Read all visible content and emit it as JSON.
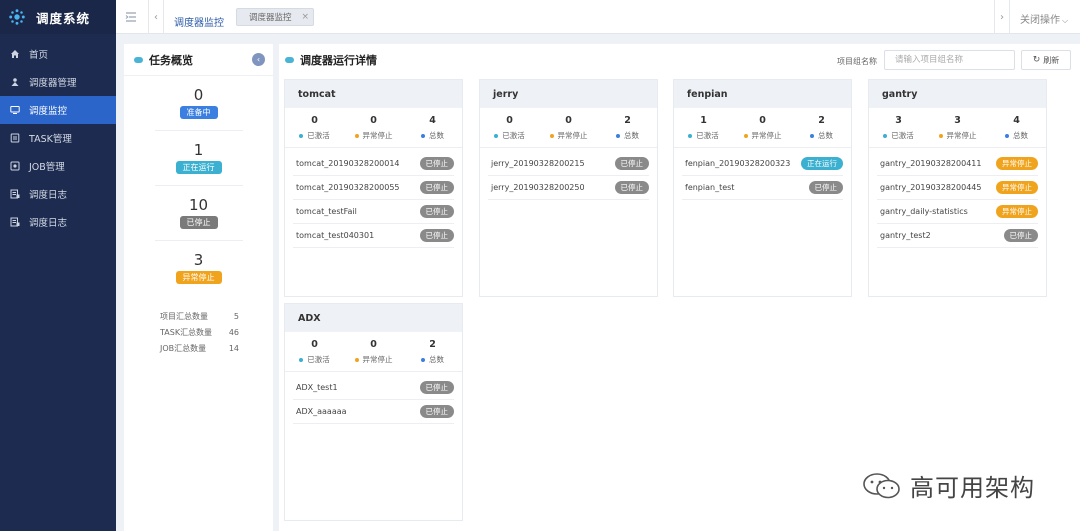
{
  "app": {
    "title": "调度系统"
  },
  "sidebar": {
    "items": [
      {
        "label": "首页",
        "icon": "home-icon"
      },
      {
        "label": "调度器管理",
        "icon": "scheduler-icon"
      },
      {
        "label": "调度监控",
        "icon": "monitor-icon",
        "active": true
      },
      {
        "label": "TASK管理",
        "icon": "task-icon"
      },
      {
        "label": "JOB管理",
        "icon": "job-icon"
      },
      {
        "label": "调度日志",
        "icon": "log-icon"
      },
      {
        "label": "调度日志",
        "icon": "log-icon"
      }
    ]
  },
  "topbar": {
    "page_title": "调度器监控",
    "tab_label": "调度器监控",
    "tab_close": "×",
    "close_ops": "关闭操作"
  },
  "overview": {
    "title": "任务概览",
    "stats": [
      {
        "value": "0",
        "label": "准备中",
        "color": "#3b7fe0"
      },
      {
        "value": "1",
        "label": "正在运行",
        "color": "#3bb0d0"
      },
      {
        "value": "10",
        "label": "已停止",
        "color": "#7a7a7a"
      },
      {
        "value": "3",
        "label": "异常停止",
        "color": "#f0a41e"
      }
    ],
    "summary": [
      {
        "label": "项目汇总数量",
        "value": "5"
      },
      {
        "label": "TASK汇总数量",
        "value": "46"
      },
      {
        "label": "JOB汇总数量",
        "value": "14"
      }
    ]
  },
  "main": {
    "title": "调度器运行详情",
    "search_label": "项目组名称",
    "search_placeholder": "请输入项目组名称",
    "refresh_label": "刷新",
    "stat_labels": [
      "已激活",
      "异常停止",
      "总数"
    ],
    "stat_colors": [
      "#3bb0d0",
      "#f0a41e",
      "#3b7fe0"
    ],
    "cards": [
      {
        "name": "tomcat",
        "stats": [
          "0",
          "0",
          "4"
        ],
        "tasks": [
          {
            "name": "tomcat_20190328200014",
            "status": "已停止",
            "color": "#8a8a8a"
          },
          {
            "name": "tomcat_20190328200055",
            "status": "已停止",
            "color": "#8a8a8a"
          },
          {
            "name": "tomcat_testFail",
            "status": "已停止",
            "color": "#8a8a8a"
          },
          {
            "name": "tomcat_test040301",
            "status": "已停止",
            "color": "#8a8a8a"
          }
        ]
      },
      {
        "name": "jerry",
        "stats": [
          "0",
          "0",
          "2"
        ],
        "tasks": [
          {
            "name": "jerry_20190328200215",
            "status": "已停止",
            "color": "#8a8a8a"
          },
          {
            "name": "jerry_20190328200250",
            "status": "已停止",
            "color": "#8a8a8a"
          }
        ]
      },
      {
        "name": "fenpian",
        "stats": [
          "1",
          "0",
          "2"
        ],
        "tasks": [
          {
            "name": "fenpian_20190328200323",
            "status": "正在运行",
            "color": "#3bb0d0"
          },
          {
            "name": "fenpian_test",
            "status": "已停止",
            "color": "#8a8a8a"
          }
        ]
      },
      {
        "name": "gantry",
        "stats": [
          "3",
          "3",
          "4"
        ],
        "tasks": [
          {
            "name": "gantry_20190328200411",
            "status": "异常停止",
            "color": "#f0a41e"
          },
          {
            "name": "gantry_20190328200445",
            "status": "异常停止",
            "color": "#f0a41e"
          },
          {
            "name": "gantry_daily-statistics",
            "status": "异常停止",
            "color": "#f0a41e"
          },
          {
            "name": "gantry_test2",
            "status": "已停止",
            "color": "#8a8a8a"
          }
        ]
      },
      {
        "name": "ADX",
        "stats": [
          "0",
          "0",
          "2"
        ],
        "tasks": [
          {
            "name": "ADX_test1",
            "status": "已停止",
            "color": "#8a8a8a"
          },
          {
            "name": "ADX_aaaaaa",
            "status": "已停止",
            "color": "#8a8a8a"
          }
        ]
      }
    ]
  },
  "watermark": {
    "text": "高可用架构"
  }
}
